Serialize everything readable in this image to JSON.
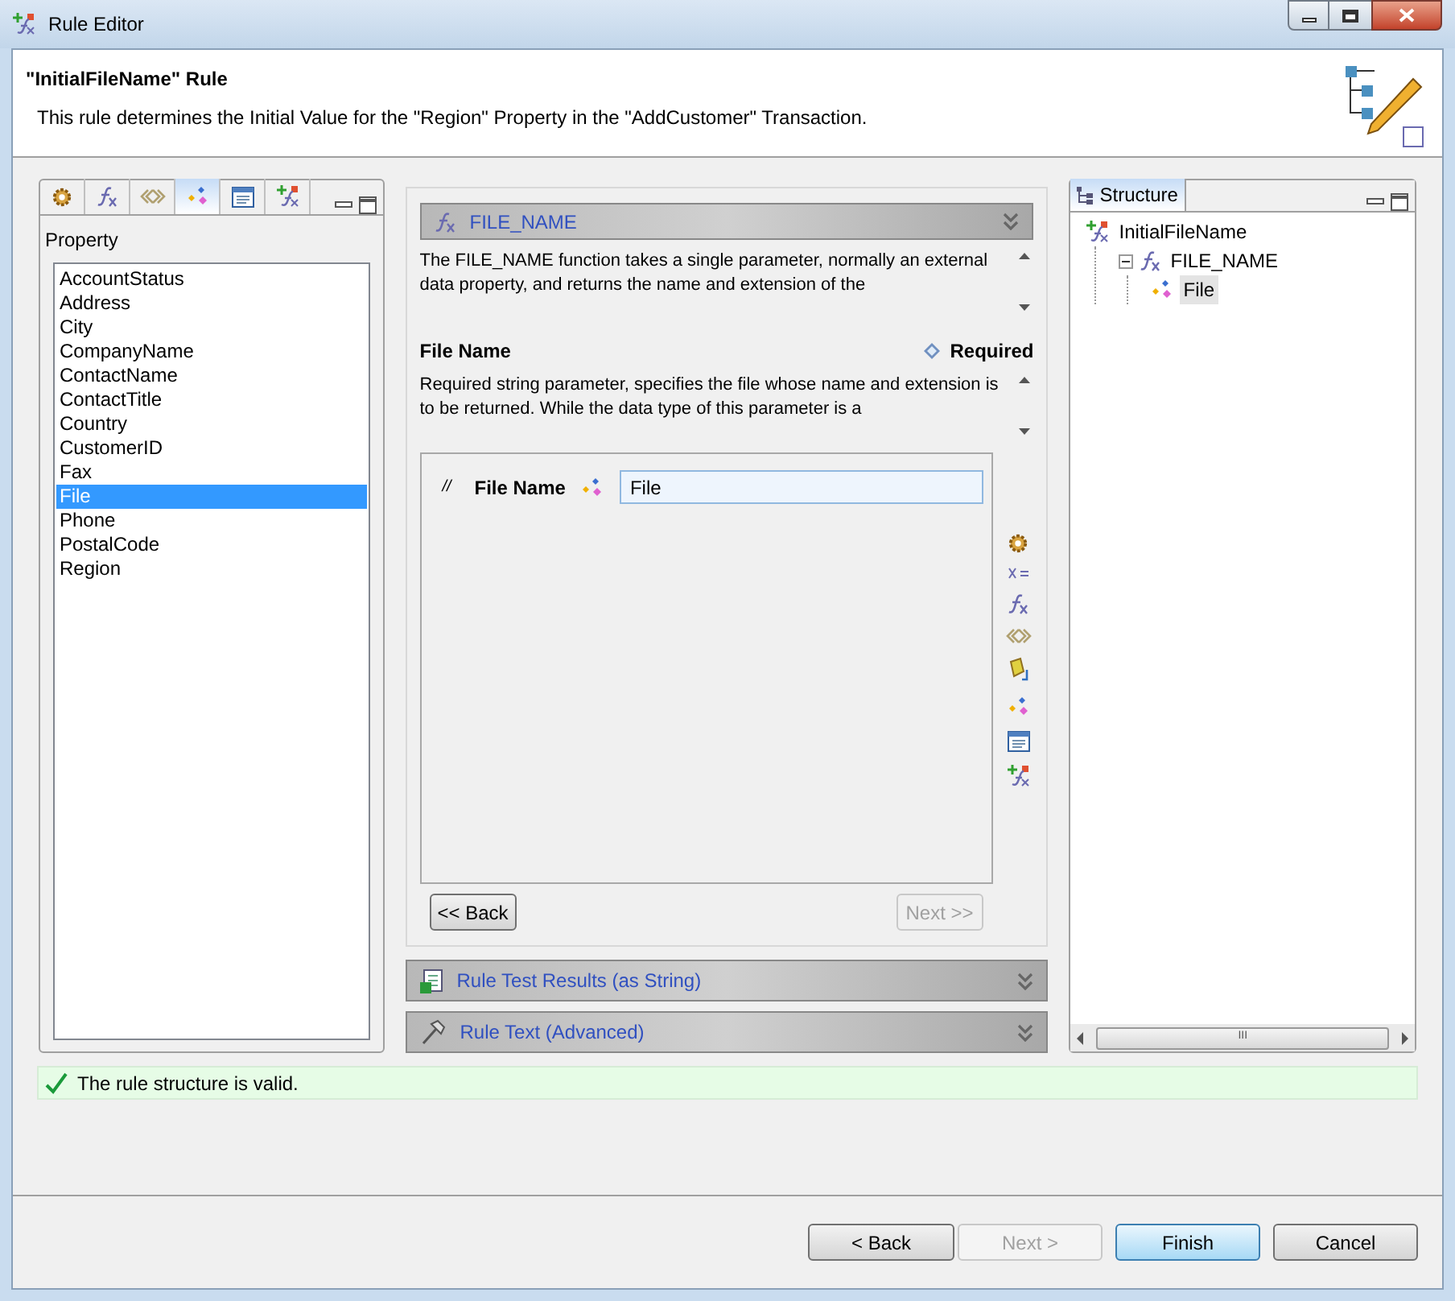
{
  "window": {
    "title": "Rule Editor"
  },
  "header": {
    "title": "\"InitialFileName\" Rule",
    "description": "This rule determines the Initial Value for the \"Region\" Property in the \"AddCustomer\" Transaction."
  },
  "left_panel": {
    "tabs": [
      {
        "selected": false
      },
      {
        "selected": false
      },
      {
        "selected": false
      },
      {
        "selected": true
      },
      {
        "selected": false
      },
      {
        "selected": false
      }
    ],
    "label": "Property",
    "items": [
      {
        "label": "AccountStatus",
        "selected": false
      },
      {
        "label": "Address",
        "selected": false
      },
      {
        "label": "City",
        "selected": false
      },
      {
        "label": "CompanyName",
        "selected": false
      },
      {
        "label": "ContactName",
        "selected": false
      },
      {
        "label": "ContactTitle",
        "selected": false
      },
      {
        "label": "Country",
        "selected": false
      },
      {
        "label": "CustomerID",
        "selected": false
      },
      {
        "label": "Fax",
        "selected": false
      },
      {
        "label": "File",
        "selected": true
      },
      {
        "label": "Phone",
        "selected": false
      },
      {
        "label": "PostalCode",
        "selected": false
      },
      {
        "label": "Region",
        "selected": false
      }
    ]
  },
  "function_panel": {
    "title": "FILE_NAME",
    "description": "The FILE_NAME function takes a single parameter, normally an external data property, and returns the name and extension of the",
    "parameter": {
      "name": "File Name",
      "required_label": "Required",
      "description": "Required string parameter, specifies the file whose name and extension is to be returned. While the data type of this parameter is a"
    },
    "argument": {
      "mark": "//",
      "label": "File Name",
      "value": "File"
    },
    "back_button": {
      "label": "<< Back",
      "disabled": false
    },
    "next_button": {
      "label": "Next >>",
      "disabled": true
    }
  },
  "sections": [
    {
      "title": "Rule Test Results (as String)",
      "kind": "results"
    },
    {
      "title": "Rule Text (Advanced)",
      "kind": "text"
    }
  ],
  "structure": {
    "tab": "Structure",
    "tree": [
      {
        "label": "InitialFileName",
        "kind": "rule",
        "selected": false,
        "children": [
          {
            "label": "FILE_NAME",
            "kind": "function",
            "expanded": true,
            "selected": false,
            "children": [
              {
                "label": "File",
                "kind": "property",
                "selected": true
              }
            ]
          }
        ]
      }
    ],
    "scrollbar_grip": "III"
  },
  "status": {
    "message": "The rule structure is valid."
  },
  "buttons": [
    {
      "label": "< Back",
      "disabled": false,
      "default": false
    },
    {
      "label": "Next >",
      "disabled": true,
      "default": false
    },
    {
      "label": "Finish",
      "disabled": false,
      "default": true
    },
    {
      "label": "Cancel",
      "disabled": false,
      "default": false
    }
  ]
}
